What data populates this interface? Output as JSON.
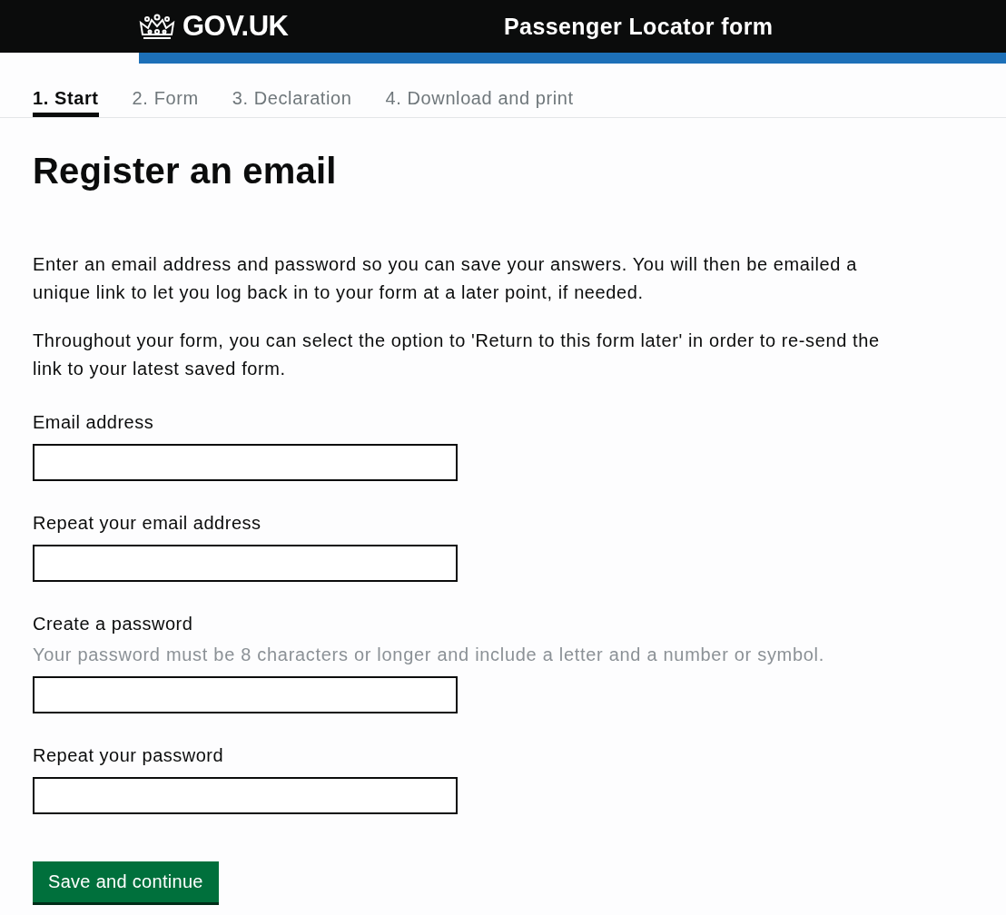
{
  "header": {
    "logo": "GOV.UK",
    "service": "Passenger Locator form"
  },
  "steps": [
    {
      "label": "1. Start",
      "selected": true
    },
    {
      "label": "2. Form",
      "selected": false
    },
    {
      "label": "3. Declaration",
      "selected": false
    },
    {
      "label": "4. Download and print",
      "selected": false
    }
  ],
  "heading": "Register an email",
  "paragraphs": [
    "Enter an email address and password so you can save your answers. You will then be emailed a unique link to let you log back in to your form at a later point, if needed.",
    "Throughout your form, you can select the option to 'Return to this form later' in order to re-send the link to your latest saved form."
  ],
  "fields": [
    {
      "label": "Email address"
    },
    {
      "label": "Repeat your email address"
    },
    {
      "label": "Create a password",
      "hint": "Your password must be 8 characters or longer and include a letter and a number or symbol."
    },
    {
      "label": "Repeat your password"
    }
  ],
  "button": "Save and continue"
}
